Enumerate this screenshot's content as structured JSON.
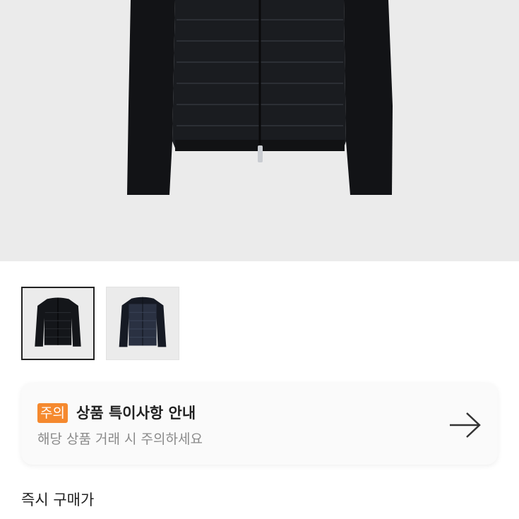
{
  "product": {
    "images": [
      {
        "name": "black-jacket",
        "selected": true,
        "color": "#14161a"
      },
      {
        "name": "navy-jacket",
        "selected": false,
        "color": "#2a3142"
      }
    ]
  },
  "notice": {
    "badge": "주의",
    "title": "상품 특이사항 안내",
    "subtitle": "해당 상품 거래 시 주의하세요",
    "arrow_icon": "arrow-right-icon",
    "badge_color": "#f5892e"
  },
  "price": {
    "label": "즉시 구매가"
  }
}
